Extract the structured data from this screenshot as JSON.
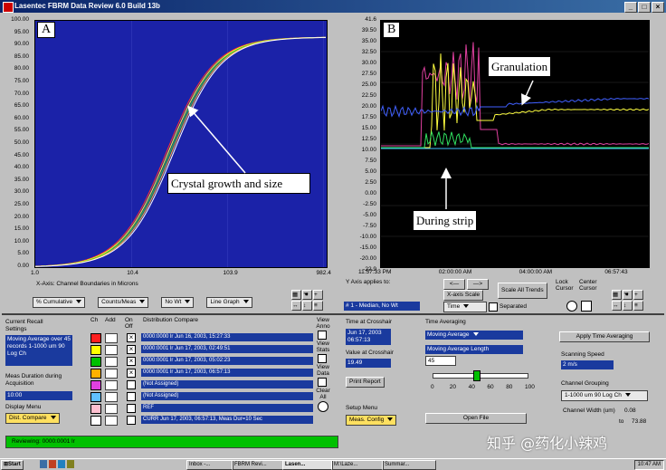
{
  "window": {
    "title": "Lasentec FBRM Data Review 6.0 Build 13b"
  },
  "panel_a": {
    "letter": "A",
    "y_ticks": [
      "100.00",
      "95.00",
      "90.00",
      "85.00",
      "80.00",
      "75.00",
      "70.00",
      "65.00",
      "60.00",
      "55.00",
      "50.00",
      "45.00",
      "40.00",
      "35.00",
      "30.00",
      "25.00",
      "20.00",
      "15.00",
      "10.00",
      "5.00",
      "0.00"
    ],
    "x_ticks": [
      "1.0",
      "10.4",
      "103.9",
      "982.4"
    ],
    "x_axis_label": "X-Axis: Channel Boundaries in Microns",
    "annotation": "Crystal growth and size",
    "dropdowns": [
      "% Cumulative",
      "Counts/Meas",
      "No Wt",
      "Line Graph"
    ]
  },
  "panel_b": {
    "letter": "B",
    "y_ticks": [
      "41.6",
      "39.50",
      "35.00",
      "32.50",
      "30.00",
      "27.50",
      "25.00",
      "22.50",
      "20.00",
      "17.50",
      "15.00",
      "12.50",
      "10.00",
      "7.50",
      "5.00",
      "2.50",
      "0.00",
      "-2.50",
      "-5.00",
      "-7.50",
      "-10.00",
      "-15.00",
      "-20.00",
      "-22.9"
    ],
    "x_ticks": [
      "11:57:33 PM",
      "02:00:00 AM",
      "04:00:00 AM",
      "06:57:43"
    ],
    "annotation_granulation": "Granulation",
    "annotation_strip": "During strip",
    "y_axis_applies_label": "Y Axis applies to:",
    "y_axis_applies_value": "# 1 - Median, No Wt",
    "x_scale_label": "X-axis Scale",
    "scale_button": "Scale All Trends",
    "lock_cursor": "Lock Cursor",
    "center_cursor": "Center Cursor",
    "time_dropdown": "Time",
    "separated_label": "Separated"
  },
  "recall": {
    "title": "Current Recall Settings",
    "settings_text": "Moving Average over 45 records 1-1000 um 90 Log Ch",
    "meas_duration_label": "Meas Duration during Acquisition",
    "meas_duration_value": "10:00",
    "display_menu_label": "Display Menu",
    "display_menu_value": "Dist. Compare"
  },
  "distribution": {
    "col_ch": "Ch",
    "col_add": "Add",
    "col_on": "On Off",
    "col_compare": "Distribution Compare",
    "rows": [
      {
        "color": "#ff2020",
        "checked": true,
        "text": "0000:0000 lr Jun 16, 2003, 15:27:33"
      },
      {
        "color": "#ffff00",
        "checked": true,
        "text": "0000:0001 lr Jun 17, 2003, 02:49:51"
      },
      {
        "color": "#00c000",
        "checked": true,
        "text": "0000:0001 lr Jun 17, 2003, 05:02:23"
      },
      {
        "color": "#ffb000",
        "checked": true,
        "text": "0000:0001 lr Jun 17, 2003, 06:57:13"
      },
      {
        "color": "#e040e0",
        "checked": false,
        "text": "(Not Assigned)"
      },
      {
        "color": "#60c0ff",
        "checked": false,
        "text": "(Not Assigned)"
      },
      {
        "color": "#ffc0d0",
        "checked": false,
        "text": "REF"
      },
      {
        "color": "#ffffff",
        "checked": false,
        "text": "CURR  Jun 17, 2003, 06:57:13, Meas Dur=10 Sec"
      }
    ],
    "view_labels": [
      "View Anno",
      "View Stats",
      "View Data",
      "Clear All"
    ]
  },
  "crosshair": {
    "time_label": "Time at Crosshair",
    "time_value": "Jun 17, 2003 06:57:13",
    "value_label": "Value at Crosshair",
    "value_value": "19.49",
    "print_report": "Print Report",
    "setup_menu_label": "Setup Menu",
    "setup_menu_value": "Meas. Config"
  },
  "averaging": {
    "title": "Time Averaging",
    "mode": "Moving Average",
    "length_label": "Moving Average Length",
    "length_value": "45",
    "slider_ticks": [
      "0",
      "20",
      "40",
      "60",
      "80",
      "100"
    ],
    "slider_value": 45,
    "apply_button": "Apply Time Averaging",
    "open_file": "Open File"
  },
  "scanning": {
    "speed_label": "Scanning Speed",
    "speed_value": "2 m/s",
    "grouping_label": "Channel Grouping",
    "grouping_value": "1-1000 um 90 Log Ch",
    "width_label": "Channel Width (um)",
    "width_value": "0.08",
    "to_label": "to",
    "to_value": "73.88"
  },
  "status": {
    "text": "Reviewing: 0000:0001 lr"
  },
  "taskbar": {
    "start": "Start",
    "items": [
      "Inbox -...",
      "FBRM Revi...",
      "Lasen...",
      "M:\\Laze...",
      "Summar..."
    ],
    "time": "10:47 AM"
  },
  "watermark": "知乎 @药化小辣鸡"
}
